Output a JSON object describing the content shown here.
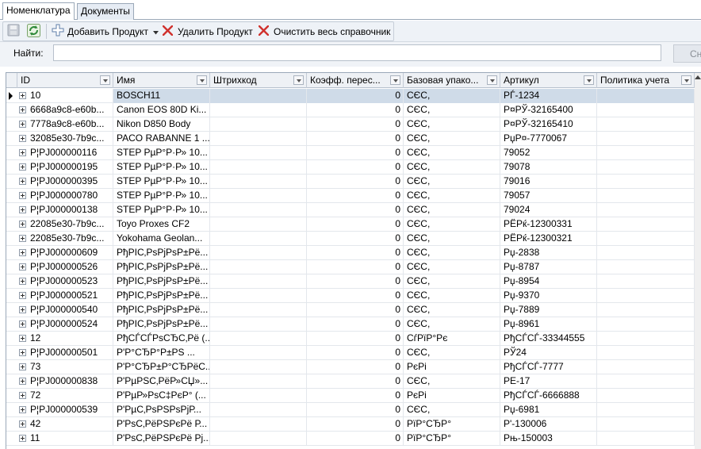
{
  "tabs": [
    {
      "label": "Номенклатура"
    },
    {
      "label": "Документы"
    }
  ],
  "toolbar": {
    "add_label": "Добавить Продукт",
    "delete_label": "Удалить Продукт",
    "clear_label": "Очистить весь справочник"
  },
  "search": {
    "label": "Найти:",
    "value": "",
    "button_label": "Сн"
  },
  "grid": {
    "columns": [
      {
        "label": "ID"
      },
      {
        "label": "Имя"
      },
      {
        "label": "Штрихкод"
      },
      {
        "label": "Коэфф. перес..."
      },
      {
        "label": "Базовая упако..."
      },
      {
        "label": "Артикул"
      },
      {
        "label": "Политика учета"
      }
    ],
    "rows": [
      {
        "id": "10",
        "name": "BOSCH11",
        "barcode": "",
        "coef": "0",
        "unit": "СЄС,",
        "article": "РЃ-1234",
        "policy": ""
      },
      {
        "id": "6668a9c8-e60b...",
        "name": "Canon EOS 80D Ki...",
        "barcode": "",
        "coef": "0",
        "unit": "СЄС,",
        "article": "Р¤РЎ-32165400",
        "policy": ""
      },
      {
        "id": "7778a9c8-e60b...",
        "name": "Nikon D850 Body",
        "barcode": "",
        "coef": "0",
        "unit": "СЄС,",
        "article": "Р¤РЎ-32165410",
        "policy": ""
      },
      {
        "id": "32085e30-7b9c...",
        "name": "PACO RABANNE 1 ...",
        "barcode": "",
        "coef": "0",
        "unit": "СЄС,",
        "article": "РџР¤-7770067",
        "policy": ""
      },
      {
        "id": "Р¦РЈ000000116",
        "name": "STEP РµР°Р·Р» 10...",
        "barcode": "",
        "coef": "0",
        "unit": "СЄС,",
        "article": "79052",
        "policy": ""
      },
      {
        "id": "Р¦РЈ000000195",
        "name": "STEP РµР°Р·Р» 10...",
        "barcode": "",
        "coef": "0",
        "unit": "СЄС,",
        "article": "79078",
        "policy": ""
      },
      {
        "id": "Р¦РЈ000000395",
        "name": "STEP РµР°Р·Р» 10...",
        "barcode": "",
        "coef": "0",
        "unit": "СЄС,",
        "article": "79016",
        "policy": ""
      },
      {
        "id": "Р¦РЈ000000780",
        "name": "STEP РµР°Р·Р» 10...",
        "barcode": "",
        "coef": "0",
        "unit": "СЄС,",
        "article": "79057",
        "policy": ""
      },
      {
        "id": "Р¦РЈ000000138",
        "name": "STEP РµР°Р·Р» 10...",
        "barcode": "",
        "coef": "0",
        "unit": "СЄС,",
        "article": "79024",
        "policy": ""
      },
      {
        "id": "22085e30-7b9c...",
        "name": "Toyo Proxes CF2",
        "barcode": "",
        "coef": "0",
        "unit": "СЄС,",
        "article": "РЁРќ-12300331",
        "policy": ""
      },
      {
        "id": "22085e30-7b9c...",
        "name": "Yokohama Geolan...",
        "barcode": "",
        "coef": "0",
        "unit": "СЄС,",
        "article": "РЁРќ-12300321",
        "policy": ""
      },
      {
        "id": "Р¦РЈ000000609",
        "name": "РђРІС‚РѕРјРѕР±Рё...",
        "barcode": "",
        "coef": "0",
        "unit": "СЄС,",
        "article": "Рџ-2838",
        "policy": ""
      },
      {
        "id": "Р¦РЈ000000526",
        "name": "РђРІС‚РѕРјРѕР±Рё...",
        "barcode": "",
        "coef": "0",
        "unit": "СЄС,",
        "article": "Рџ-8787",
        "policy": ""
      },
      {
        "id": "Р¦РЈ000000523",
        "name": "РђРІС‚РѕРјРѕР±Рё...",
        "barcode": "",
        "coef": "0",
        "unit": "СЄС,",
        "article": "Рџ-8954",
        "policy": ""
      },
      {
        "id": "Р¦РЈ000000521",
        "name": "РђРІС‚РѕРјРѕР±Рё...",
        "barcode": "",
        "coef": "0",
        "unit": "СЄС,",
        "article": "Рџ-9370",
        "policy": ""
      },
      {
        "id": "Р¦РЈ000000540",
        "name": "РђРІС‚РѕРјРѕР±Рё...",
        "barcode": "",
        "coef": "0",
        "unit": "СЄС,",
        "article": "Рџ-7889",
        "policy": ""
      },
      {
        "id": "Р¦РЈ000000524",
        "name": "РђРІС‚РѕРјРѕР±Рё...",
        "barcode": "",
        "coef": "0",
        "unit": "СЄС,",
        "article": "Рџ-8961",
        "policy": ""
      },
      {
        "id": "12",
        "name": "РђСЃСЃРѕСЂС‚Рё (...",
        "barcode": "",
        "coef": "0",
        "unit": "СѓРїР°Рє",
        "article": "РђСЃСЃ-33344555",
        "policy": ""
      },
      {
        "id": "Р¦РЈ000000501",
        "name": "Р'Р°СЂР°Р±РЅ ...",
        "barcode": "",
        "coef": "0",
        "unit": "СЄС,",
        "article": "РЎ24",
        "policy": ""
      },
      {
        "id": "73",
        "name": "Р'Р°СЂР±Р°СЂРёС...",
        "barcode": "",
        "coef": "0",
        "unit": "РєРі",
        "article": "РђСЃСЃ-7777",
        "policy": ""
      },
      {
        "id": "Р¦РЈ000000838",
        "name": "Р'РµРЅС‚РёР»СЏ»...",
        "barcode": "",
        "coef": "0",
        "unit": "СЄС,",
        "article": "РЕ-17",
        "policy": ""
      },
      {
        "id": "72",
        "name": "Р'РµР»РѕС‡РєР° (...",
        "barcode": "",
        "coef": "0",
        "unit": "РєРі",
        "article": "РђСЃСЃ-6666888",
        "policy": ""
      },
      {
        "id": "Р¦РЈ000000539",
        "name": "Р'РµС‚РѕРЅРѕРјР...",
        "barcode": "",
        "coef": "0",
        "unit": "СЄС,",
        "article": "Рџ-6981",
        "policy": ""
      },
      {
        "id": "42",
        "name": "Р'РѕС‚РёРЅРєРё Р...",
        "barcode": "",
        "coef": "0",
        "unit": "РїР°СЂР°",
        "article": "Р'-130006",
        "policy": ""
      },
      {
        "id": "11",
        "name": "Р'РѕС‚РёРЅРєРё Рј...",
        "barcode": "",
        "coef": "0",
        "unit": "РїР°СЂР°",
        "article": "Рњ-150003",
        "policy": ""
      }
    ]
  }
}
